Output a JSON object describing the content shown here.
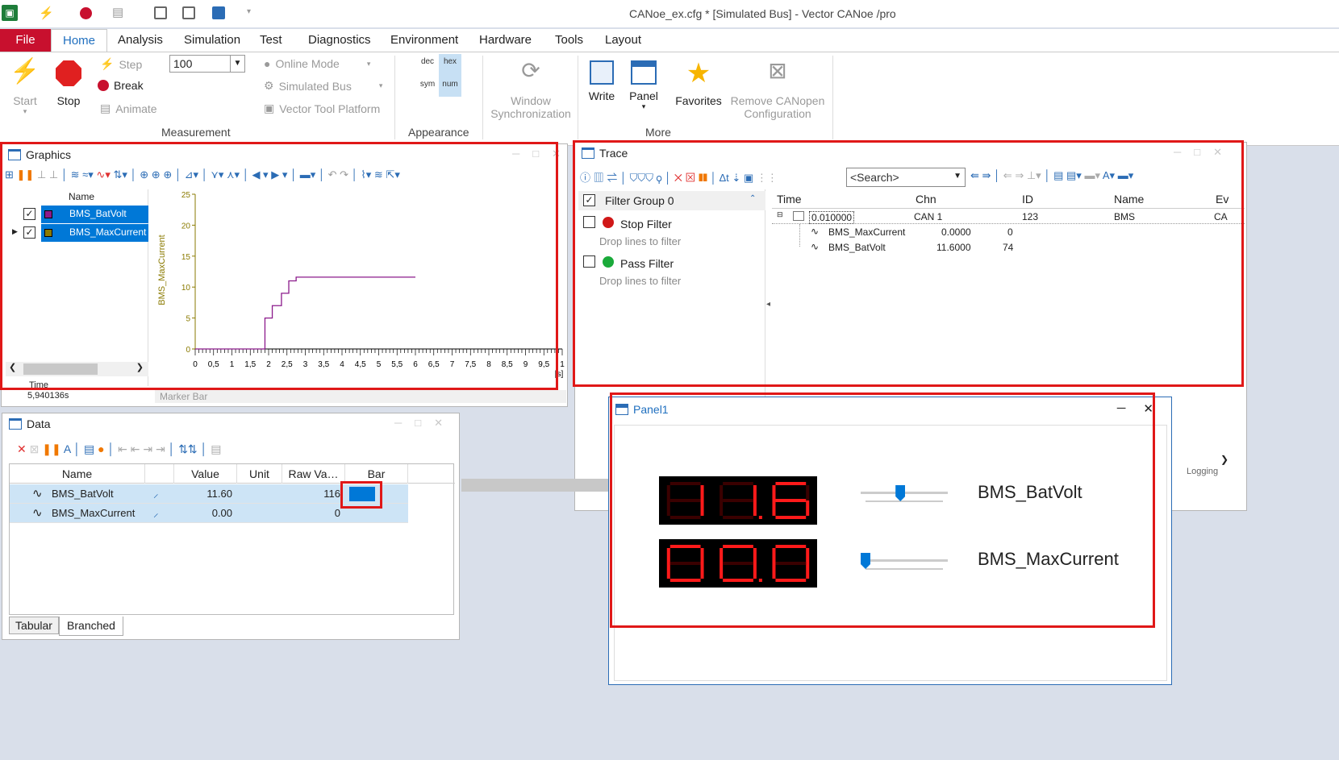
{
  "window": {
    "title": "CANoe_ex.cfg * [Simulated Bus] - Vector CANoe /pro"
  },
  "menu": {
    "file": "File",
    "tabs": [
      "Home",
      "Analysis",
      "Simulation",
      "Test",
      "Diagnostics",
      "Environment",
      "Hardware",
      "Tools",
      "Layout"
    ]
  },
  "ribbon": {
    "start": "Start",
    "stop": "Stop",
    "step": "Step",
    "break": "Break",
    "animate": "Animate",
    "step_value": "100",
    "online_mode": "Online Mode",
    "simulated_bus": "Simulated Bus",
    "vector_tool_platform": "Vector Tool Platform",
    "group_measurement": "Measurement",
    "dec": "dec",
    "hex": "hex",
    "sym": "sym",
    "num": "num",
    "group_appearance": "Appearance",
    "window_sync_1": "Window",
    "window_sync_2": "Synchronization",
    "write": "Write",
    "panel": "Panel",
    "favorites": "Favorites",
    "remove_canopen_1": "Remove CANopen",
    "remove_canopen_2": "Configuration",
    "group_more": "More"
  },
  "graphics": {
    "title": "Graphics",
    "col_name": "Name",
    "signals": [
      {
        "name": "BMS_BatVolt",
        "color": "#8b1a8b"
      },
      {
        "name": "BMS_MaxCurrent",
        "color": "#8a7a00"
      }
    ],
    "time_label": "Time",
    "time_value": "5,940136s",
    "marker_bar": "Marker Bar",
    "y_label": "BMS_MaxCurrent",
    "y_ticks": [
      "25",
      "20",
      "15",
      "10",
      "5",
      "0"
    ],
    "x_ticks": [
      "0",
      "0,5",
      "1",
      "1,5",
      "2",
      "2,5",
      "3",
      "3,5",
      "4",
      "4,5",
      "5",
      "5,5",
      "6",
      "6,5",
      "7",
      "7,5",
      "8",
      "8,5",
      "9",
      "9,5",
      "1"
    ],
    "x_unit": "[s]"
  },
  "chart_data": {
    "type": "line",
    "x": [
      0,
      1.9,
      1.9,
      2.1,
      2.1,
      2.35,
      2.35,
      2.55,
      2.55,
      2.75,
      2.75,
      3.0,
      3.0,
      6.0
    ],
    "series": [
      {
        "name": "BMS_MaxCurrent",
        "values": [
          0,
          0,
          5,
          5,
          7,
          7,
          9,
          9,
          11,
          11,
          11.6,
          11.6,
          11.6,
          11.6
        ]
      }
    ],
    "ylabel": "BMS_MaxCurrent",
    "xlabel": "[s]",
    "xlim": [
      0,
      10
    ],
    "ylim": [
      0,
      25
    ],
    "grid": false
  },
  "trace": {
    "title": "Trace",
    "search_placeholder": "<Search>",
    "filter_group": "Filter Group 0",
    "stop_filter": "Stop Filter",
    "stop_hint": "Drop lines to filter",
    "pass_filter": "Pass Filter",
    "pass_hint": "Drop lines to filter",
    "columns": [
      "Time",
      "Chn",
      "ID",
      "Name",
      "Ev"
    ],
    "row": {
      "time": "0.010000",
      "chn": "CAN 1",
      "id": "123",
      "name": "BMS",
      "ev": "CA"
    },
    "sub_rows": [
      {
        "name": "BMS_MaxCurrent",
        "value": "0.0000",
        "raw": "0"
      },
      {
        "name": "BMS_BatVolt",
        "value": "11.6000",
        "raw": "74"
      }
    ],
    "logging": "Logging"
  },
  "data_window": {
    "title": "Data",
    "columns": [
      "Name",
      "",
      "Value",
      "Unit",
      "Raw Va…",
      "Bar"
    ],
    "rows": [
      {
        "name": "BMS_BatVolt",
        "value": "11.60",
        "unit": "",
        "raw": "116"
      },
      {
        "name": "BMS_MaxCurrent",
        "value": "0.00",
        "unit": "",
        "raw": "0"
      }
    ],
    "tabs": [
      "Tabular",
      "Branched"
    ]
  },
  "panel": {
    "title": "Panel1",
    "rows": [
      {
        "display": "11.6",
        "label": "BMS_BatVolt",
        "slider": 0.45
      },
      {
        "display": "00.0",
        "label": "BMS_MaxCurrent",
        "slider": 0.0
      }
    ]
  },
  "colors": {
    "accent": "#1f6fbf",
    "file_red": "#c8102e",
    "highlight": "#c7e0f4",
    "select_blue": "#0078d7",
    "annot_red": "#e01818"
  }
}
